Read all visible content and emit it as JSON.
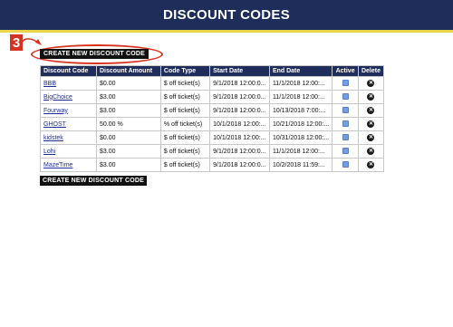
{
  "header": {
    "title": "DISCOUNT CODES"
  },
  "callout": {
    "number": "3"
  },
  "create_button_label": "CREATE NEW DISCOUNT CODE",
  "table": {
    "columns": [
      "Discount Code",
      "Discount Amount",
      "Code Type",
      "Start Date",
      "End Date",
      "Active",
      "Delete"
    ],
    "rows": [
      {
        "code": "BBB",
        "amount": "$0.00",
        "type": "$ off ticket(s)",
        "start": "9/1/2018 12:00:0...",
        "end": "11/1/2018 12:00:...",
        "active": true
      },
      {
        "code": "BigChoice",
        "amount": "$3.00",
        "type": "$ off ticket(s)",
        "start": "9/1/2018 12:00:0...",
        "end": "11/1/2018 12:00:...",
        "active": true
      },
      {
        "code": "Fourway",
        "amount": "$3.00",
        "type": "$ off ticket(s)",
        "start": "9/1/2018 12:00:0...",
        "end": "10/13/2018 7:00:...",
        "active": true
      },
      {
        "code": "GHOST",
        "amount": "50.00 %",
        "type": "% off ticket(s)",
        "start": "10/1/2018 12:00:...",
        "end": "10/21/2018 12:00:...",
        "active": true
      },
      {
        "code": "kidstek",
        "amount": "$0.00",
        "type": "$ off ticket(s)",
        "start": "10/1/2018 12:00:...",
        "end": "10/31/2018 12:00:...",
        "active": true
      },
      {
        "code": "Lohi",
        "amount": "$3.00",
        "type": "$ off ticket(s)",
        "start": "9/1/2018 12:00:0...",
        "end": "11/1/2018 12:00:...",
        "active": true
      },
      {
        "code": "MazeTime",
        "amount": "$3.00",
        "type": "$ off ticket(s)",
        "start": "9/1/2018 12:00:0...",
        "end": "10/2/2018 11:59:...",
        "active": true
      }
    ]
  },
  "icons": {
    "active": "checkbox-icon",
    "delete": "close-circle-icon"
  },
  "colors": {
    "header_bg": "#1f2d5a",
    "header_rule": "#e8d54a",
    "callout": "#d8321e",
    "button_bg": "#111111"
  }
}
